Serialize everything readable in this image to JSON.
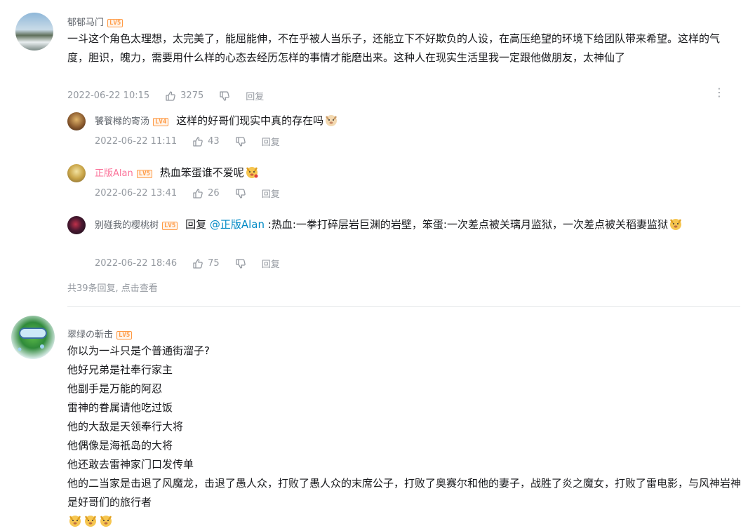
{
  "comments": [
    {
      "user": "郁郁马门",
      "level": "LV5",
      "text": "一斗这个角色太理想，太完美了，能屈能伸，不在乎被人当乐子，还能立下不好欺负的人设，在高压绝望的环境下给团队带来希望。这样的气度，胆识，魄力，需要用什么样的心态去经历怎样的事情才能磨出来。这种人在现实生活里我一定跟他做朋友，太神仙了",
      "time": "2022-06-22 10:15",
      "likes": "3275",
      "reply_label": "回复",
      "replies": [
        {
          "user": "饕餮橼的寄汤",
          "level": "LV4",
          "text": "这样的好哥们现实中真的存在吗",
          "time": "2022-06-22 11:11",
          "likes": "43",
          "reply_label": "回复"
        },
        {
          "user": "正版Alan",
          "level": "LV5",
          "text": "热血笨蛋谁不爱呢",
          "time": "2022-06-22 13:41",
          "likes": "26",
          "reply_label": "回复"
        },
        {
          "user": "别碰我的樱桃树",
          "level": "LV5",
          "reply_prefix": "回复",
          "mention": "@正版Alan",
          "text": ":热血:一拳打碎层岩巨渊的岩壁，笨蛋:一次差点被关璃月监狱，一次差点被关稻妻监狱",
          "time": "2022-06-22 18:46",
          "likes": "75",
          "reply_label": "回复"
        }
      ],
      "more_replies": "共39条回复, 点击查看"
    },
    {
      "user": "翠绿の斬击",
      "level": "LV5",
      "lines": [
        "你以为一斗只是个普通街溜子?",
        "他好兄弟是社奉行家主",
        "他副手是万能的阿忍",
        "雷神的眷属请他吃过饭",
        "他的大敌是天领奉行大将",
        "他偶像是海祇岛的大将",
        "他还敢去雷神家门口发传单",
        "他的二当家是击退了风魔龙，击退了愚人众，打败了愚人众的末席公子，打败了奥赛尔和他的妻子，战胜了炎之魔女，打败了雷电影，与风神岩神是好哥们的旅行者"
      ]
    }
  ]
}
